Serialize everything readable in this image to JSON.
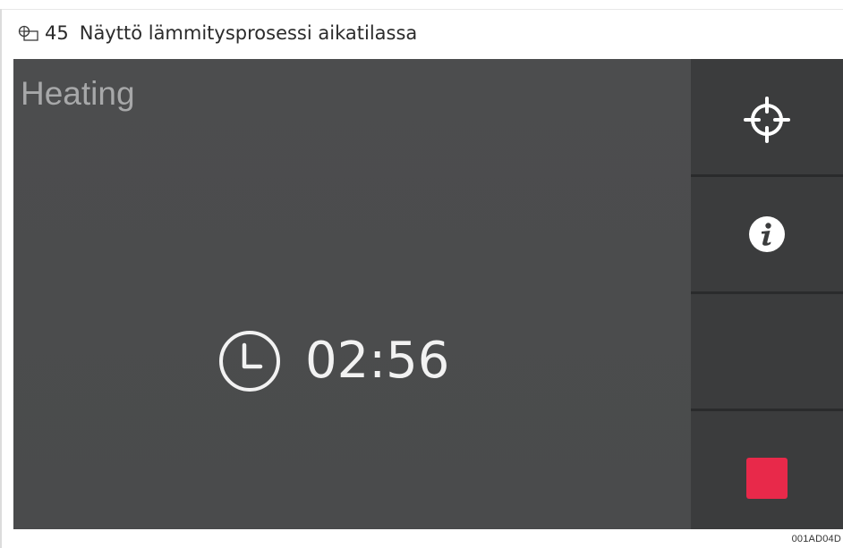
{
  "caption": {
    "number": "45",
    "text": "Näyttö lämmitysprosessi aikatilassa"
  },
  "screen": {
    "status_title": "Heating",
    "timer_value": "02:56"
  },
  "sidebar": {
    "buttons": [
      {
        "icon": "crosshair-icon"
      },
      {
        "icon": "info-icon"
      },
      {
        "icon": ""
      },
      {
        "icon": "stop-icon"
      }
    ]
  },
  "colors": {
    "screen_bg": "#4a4b4c",
    "sidebar_bg": "#3b3c3d",
    "stop_red": "#e8294a",
    "text_light": "#f2f2f2",
    "title_gray": "#a7a8a9"
  },
  "reference_code": "001AD04D"
}
